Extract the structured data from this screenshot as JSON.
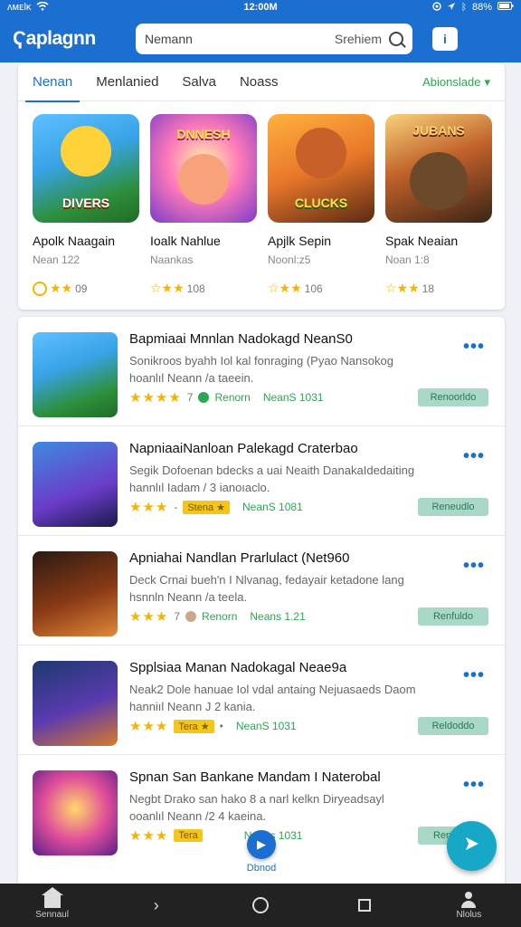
{
  "status_bar": {
    "carrier": "ᴧᴍᴇlᴋ",
    "time": "12:00M",
    "battery": "88%"
  },
  "app_bar": {
    "logo": "Ҁaplagnn",
    "search_placeholder": "Nemann",
    "search_button": "Srehiem"
  },
  "featured": {
    "tabs": [
      {
        "label": "Nenan",
        "active": true
      },
      {
        "label": "Menlanied",
        "active": false
      },
      {
        "label": "Salva",
        "active": false
      },
      {
        "label": "Noass",
        "active": false
      }
    ],
    "filter_label": "Abionslade",
    "cards": [
      {
        "thumb_text": "DIVERS",
        "name": "Apolk Naagain",
        "sub": "Nean 122",
        "rating": "09"
      },
      {
        "thumb_text": "DNNESH",
        "name": "Ioalk Nahlue",
        "sub": "Naankas",
        "rating": "108"
      },
      {
        "thumb_text": "CLUCKS",
        "name": "Apjlk Sepin",
        "sub": "Noonl:z5",
        "rating": "106"
      },
      {
        "thumb_text": "JUBANS",
        "name": "Spak Neaian",
        "sub": "Noan 1:8",
        "rating": "18"
      }
    ]
  },
  "apps": [
    {
      "title": "Bapmiaai Mnnlan Nadokagd NeanS0",
      "desc1": "Sonikroos byahh Iol kal fonraging (Pyao Nansokog",
      "desc2": "hoanlıl Neann /a taeein.",
      "stars": "★★★★",
      "rating": "7",
      "badge_kind": "green-dot",
      "badge_text": "Renorn",
      "near": "NeanS 1031",
      "button": "Renoorldo"
    },
    {
      "title": "NapniaaiNanloan Palekagd Craterbao",
      "desc1": "Segik Dofoenan bdecks a uai Neaith DanakaIdedaiting",
      "desc2": "hannlıl Iadam / 3 ianoıaclo.",
      "stars": "★★★",
      "rating": "-",
      "badge_kind": "yellow",
      "badge_text": "Stena ★",
      "near": "NeanS 1081",
      "button": "Reneudlo"
    },
    {
      "title": "Apniahai Nandlan Prarlulact (Net960",
      "desc1": "Deck Crnai bueh'n I Nlvanag, fedayair ketadone lang",
      "desc2": "hsnnln Neann /a teela.",
      "stars": "★★★",
      "rating": "7",
      "badge_kind": "tan-dot",
      "badge_text": "Renorn",
      "near": "Neans 1.21",
      "button": "Renfuldo"
    },
    {
      "title": "Spplsiaa Manan Nadokagal Neae9a",
      "desc1": "Neak2 Dole hanuae Iol vdal antaing Nejuasaeds Daom",
      "desc2": "hanniıl Neann J 2 kania.",
      "stars": "★★★",
      "rating": "",
      "badge_kind": "yellow",
      "badge_text": "Tera ★",
      "near": "NeanS 1031",
      "button": "Reldoddo"
    },
    {
      "title": "Spnan San Bankane Mandam I Naterobal",
      "desc1": "Negbt Drako san hako 8 a narl kelkn Diryeadsayl",
      "desc2": "ooanlıl Neann /2 4 kaeina.",
      "stars": "★★★",
      "rating": "",
      "badge_kind": "yellow",
      "badge_text": "Tera",
      "near": "Neans 1031",
      "button": "Renfuldo"
    }
  ],
  "floating": {
    "small_label": "Dbnod"
  },
  "nav": {
    "home_label": "Sennaul",
    "profile_label": "Nlolus"
  }
}
